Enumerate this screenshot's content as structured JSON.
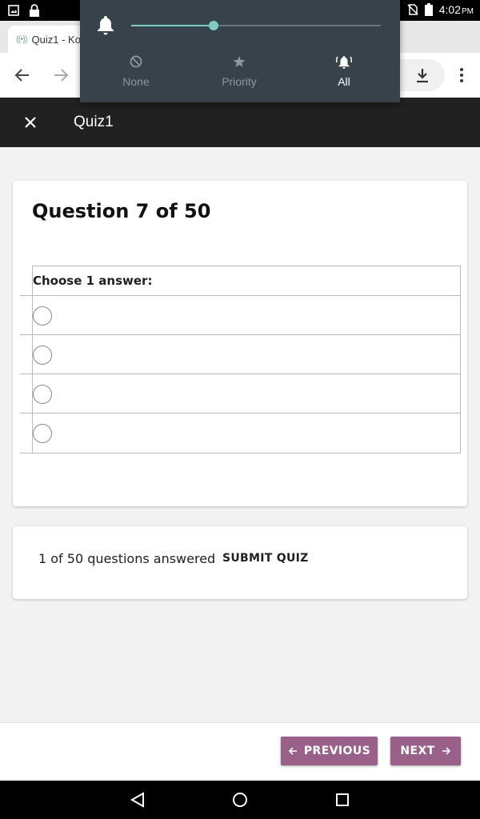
{
  "status_bar": {
    "time": "4:02",
    "ampm": "PM"
  },
  "browser": {
    "tab_title": "Quiz1 - Ko"
  },
  "volume_panel": {
    "level": 0.33,
    "modes": [
      {
        "label": "None",
        "active": false
      },
      {
        "label": "Priority",
        "active": false
      },
      {
        "label": "All",
        "active": true
      }
    ],
    "accent_color": "#80cbc4"
  },
  "app_bar": {
    "title": "Quiz1"
  },
  "question": {
    "title": "Question 7 of 50",
    "prompt": "Choose 1 answer:",
    "options_count": 4
  },
  "summary": {
    "answered_text": "1 of 50 questions answered",
    "submit_label": "SUBMIT QUIZ"
  },
  "navigation": {
    "previous_label": "PREVIOUS",
    "next_label": "NEXT",
    "button_color": "#996189"
  }
}
